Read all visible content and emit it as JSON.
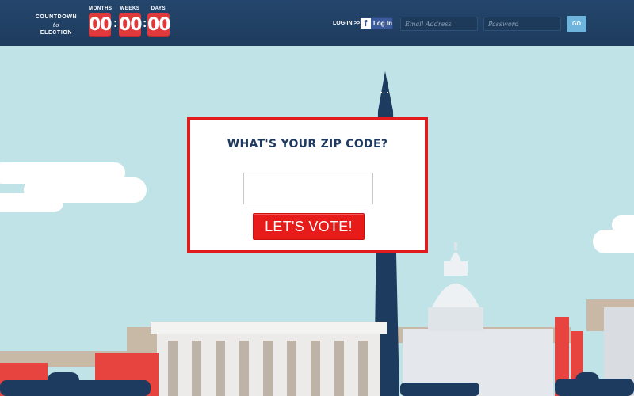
{
  "header": {
    "countdown": {
      "title_line1": "COUNTDOWN",
      "title_line2": "to",
      "title_line3": "ELECTION",
      "units": [
        {
          "label": "MONTHS",
          "value": "00"
        },
        {
          "label": "WEEKS",
          "value": "00"
        },
        {
          "label": "DAYS",
          "value": "00"
        }
      ],
      "separator": ":"
    },
    "login": {
      "label": "LOG-IN >>",
      "facebook_label": "Log In",
      "facebook_icon": "facebook-icon",
      "email_placeholder": "Email Address",
      "password_placeholder": "Password",
      "go_label": "GO"
    }
  },
  "modal": {
    "title": "WHAT'S YOUR ZIP CODE?",
    "zip_value": "",
    "submit_label": "LET'S VOTE!"
  },
  "colors": {
    "header_bg": "#1f3d60",
    "sky": "#bfe3e6",
    "accent_red": "#e21c1c",
    "navy": "#1e3a5e"
  }
}
